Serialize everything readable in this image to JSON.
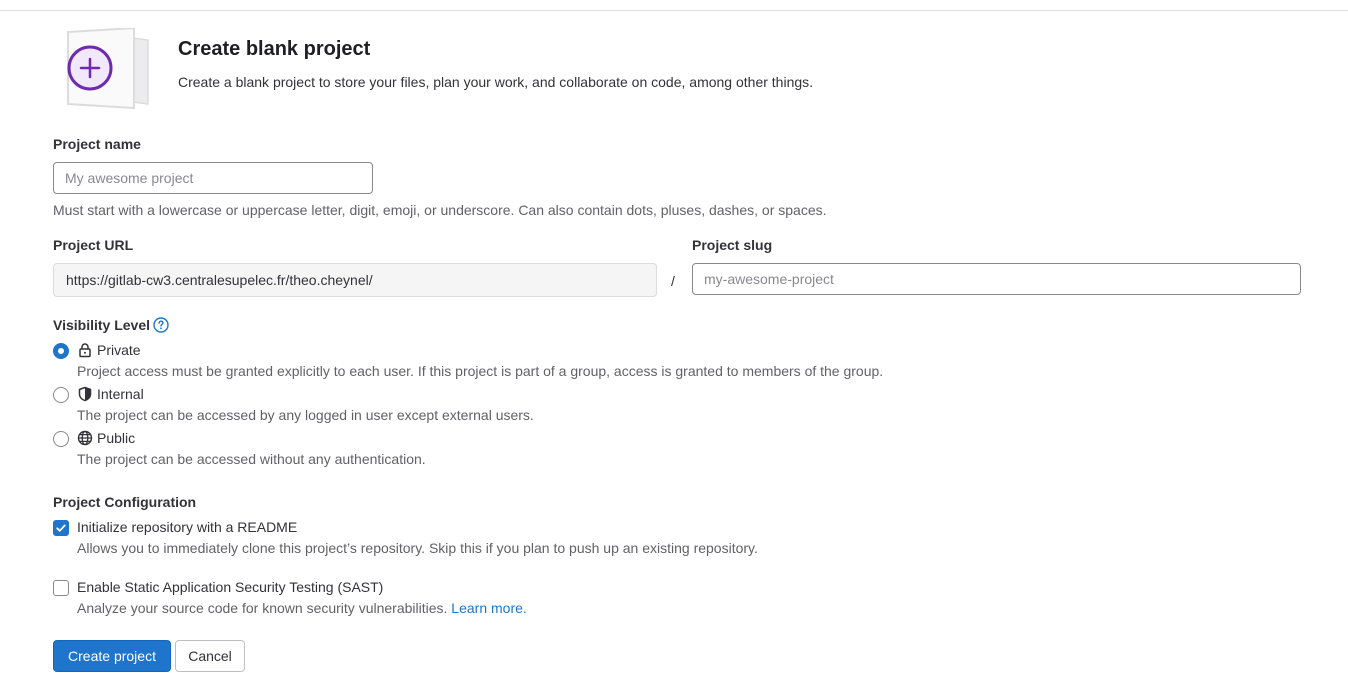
{
  "header": {
    "title": "Create blank project",
    "description": "Create a blank project to store your files, plan your work, and collaborate on code, among other things."
  },
  "project_name": {
    "label": "Project name",
    "placeholder": "My awesome project",
    "value": "",
    "help": "Must start with a lowercase or uppercase letter, digit, emoji, or underscore. Can also contain dots, pluses, dashes, or spaces."
  },
  "project_url": {
    "label": "Project URL",
    "prefix": "https://gitlab-cw3.centralesupelec.fr/theo.cheynel/",
    "separator": "/"
  },
  "project_slug": {
    "label": "Project slug",
    "placeholder": "my-awesome-project",
    "value": ""
  },
  "visibility": {
    "label": "Visibility Level",
    "selected": "private",
    "options": [
      {
        "key": "private",
        "icon": "lock-icon",
        "title": "Private",
        "description": "Project access must be granted explicitly to each user. If this project is part of a group, access is granted to members of the group."
      },
      {
        "key": "internal",
        "icon": "shield-icon",
        "title": "Internal",
        "description": "The project can be accessed by any logged in user except external users."
      },
      {
        "key": "public",
        "icon": "globe-icon",
        "title": "Public",
        "description": "The project can be accessed without any authentication."
      }
    ]
  },
  "configuration": {
    "label": "Project Configuration",
    "readme": {
      "checked": true,
      "label": "Initialize repository with a README",
      "help": "Allows you to immediately clone this project’s repository. Skip this if you plan to push up an existing repository."
    },
    "sast": {
      "checked": false,
      "label": "Enable Static Application Security Testing (SAST)",
      "help": "Analyze your source code for known security vulnerabilities.",
      "link": "Learn more."
    }
  },
  "actions": {
    "create_label": "Create project",
    "cancel_label": "Cancel"
  },
  "colors": {
    "accent": "#1f75cb",
    "illustration_purple": "#6e2ab0"
  }
}
